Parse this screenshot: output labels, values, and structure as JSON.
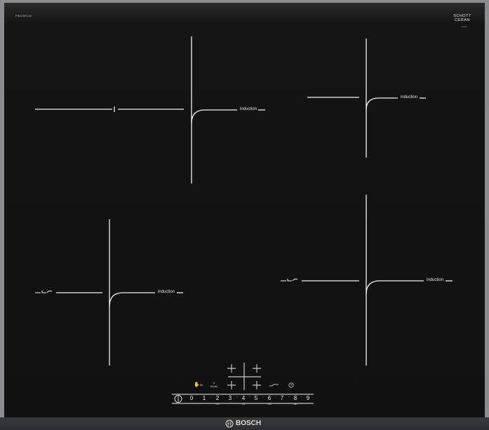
{
  "model": "PIE675FC1E",
  "glass_brand": "SCHOTT CERAN",
  "glass_sub": "ceran",
  "zones": [
    {
      "label": "induction"
    },
    {
      "label": "induction"
    },
    {
      "label": "induction"
    },
    {
      "label": "induction"
    }
  ],
  "controls": {
    "numbers": [
      "0",
      "1",
      "2",
      "3",
      "4",
      "5",
      "6",
      "7",
      "8",
      "9"
    ],
    "sub_labels": [
      "min",
      "low",
      "med",
      "max"
    ],
    "lock_label": "3s",
    "boost_label": "boost"
  },
  "brand": "BOSCH",
  "icons": [
    "power-icon",
    "child-lock-icon",
    "boost-icon",
    "plus-icon",
    "pan-icon",
    "timer-icon",
    "bosch-logo-icon"
  ]
}
